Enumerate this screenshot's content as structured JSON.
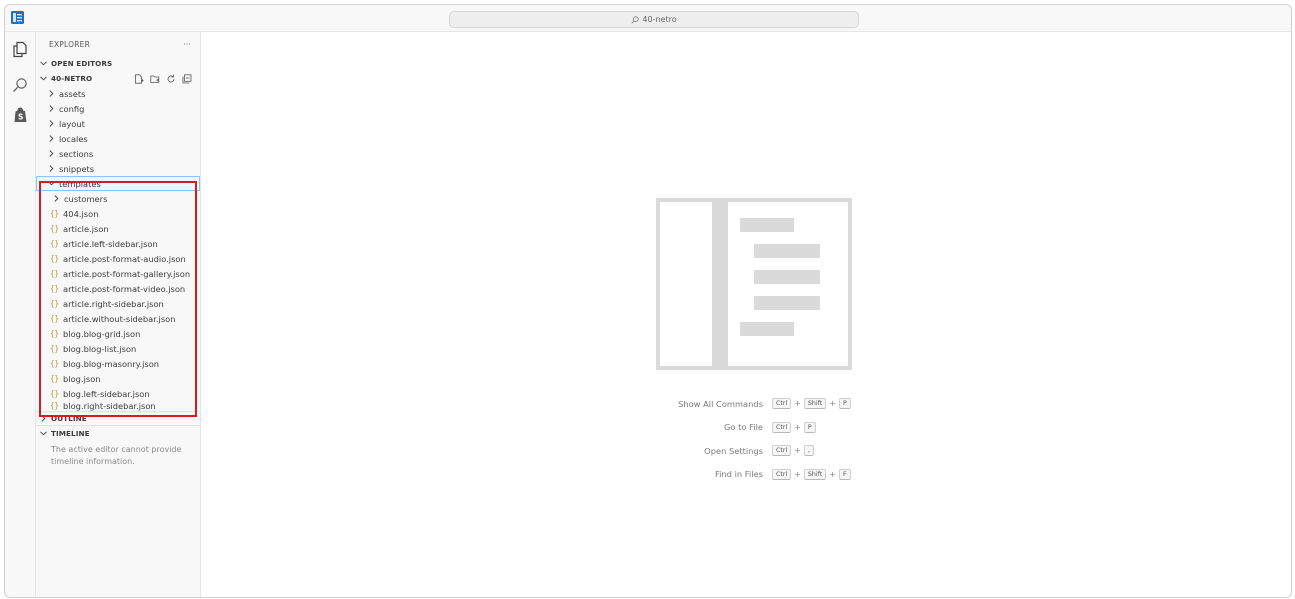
{
  "titlebar": {
    "search_text": "40-netro"
  },
  "explorer": {
    "title": "EXPLORER",
    "more": "···",
    "open_editors": "OPEN EDITORS",
    "root": "40-NETRO",
    "folders": [
      "assets",
      "config",
      "layout",
      "locales",
      "sections",
      "snippets"
    ],
    "templates_folder": "templates",
    "templates_subfolder": "customers",
    "template_files": [
      "404.json",
      "article.json",
      "article.left-sidebar.json",
      "article.post-format-audio.json",
      "article.post-format-gallery.json",
      "article.post-format-video.json",
      "article.right-sidebar.json",
      "article.without-sidebar.json",
      "blog.blog-grid.json",
      "blog.blog-list.json",
      "blog.blog-masonry.json",
      "blog.json",
      "blog.left-sidebar.json",
      "blog.right-sidebar.json"
    ],
    "file_icon": "{}",
    "outline": "OUTLINE",
    "timeline": "TIMELINE",
    "timeline_message": "The active editor cannot provide timeline information."
  },
  "icons": {
    "activity": [
      "explorer-icon",
      "search-icon",
      "shopify-icon"
    ],
    "folder_actions": [
      "new-file-icon",
      "new-folder-icon",
      "refresh-icon",
      "collapse-all-icon"
    ]
  },
  "colors": {
    "highlight_box": "#d41e1e",
    "selection_outline": "#90c2f9",
    "json_icon": "#b09a2d"
  },
  "editor": {
    "shortcuts": [
      {
        "label": "Show All Commands",
        "keys": [
          "Ctrl",
          "Shift",
          "P"
        ]
      },
      {
        "label": "Go to File",
        "keys": [
          "Ctrl",
          "P"
        ]
      },
      {
        "label": "Open Settings",
        "keys": [
          "Ctrl",
          ","
        ]
      },
      {
        "label": "Find in Files",
        "keys": [
          "Ctrl",
          "Shift",
          "F"
        ]
      }
    ],
    "plus": "+"
  }
}
